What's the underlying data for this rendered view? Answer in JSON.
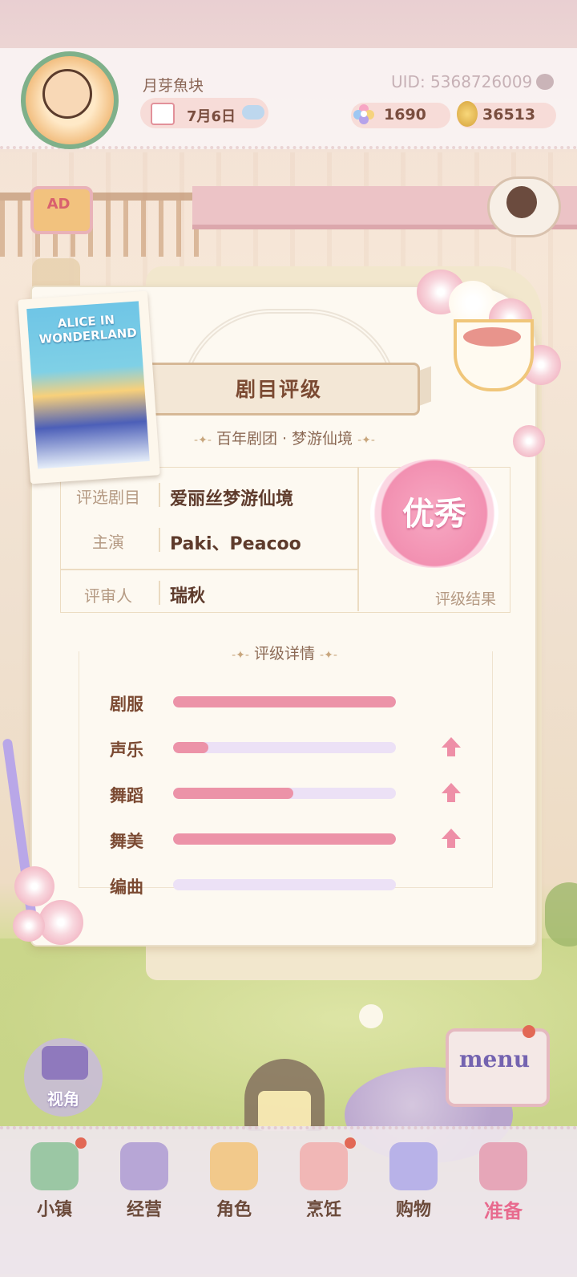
{
  "header": {
    "nickname": "月芽魚块",
    "date": "7月6日",
    "uid": "UID: 5368726009",
    "gems": "1690",
    "coins": "36513"
  },
  "side": {
    "ad_label": "AD"
  },
  "poster": {
    "title": "ALICE IN WONDERLAND"
  },
  "rating": {
    "title": "剧目评级",
    "subtitle": "百年剧团 · 梦游仙境",
    "rows": [
      {
        "label": "评选剧目",
        "value": "爱丽丝梦游仙境"
      },
      {
        "label": "主演",
        "value": "Paki、Peacoo"
      },
      {
        "label": "评审人",
        "value": "瑞秋"
      }
    ],
    "result_stamp": "优秀",
    "result_label": "评级结果",
    "details_title": "评级详情",
    "stats": [
      {
        "label": "剧服",
        "fill": 1.0,
        "arrow": false
      },
      {
        "label": "声乐",
        "fill": 0.16,
        "arrow": true
      },
      {
        "label": "舞蹈",
        "fill": 0.54,
        "arrow": true
      },
      {
        "label": "舞美",
        "fill": 1.0,
        "arrow": true
      },
      {
        "label": "编曲",
        "fill": 0.0,
        "arrow": false
      }
    ],
    "colors": {
      "fill": "#ec93a8",
      "track": "#ece1f6",
      "stamp": "#f290b1"
    }
  },
  "controls": {
    "view_label": "视角",
    "menu_label": "menu"
  },
  "nav": [
    {
      "label": "小镇",
      "icon": "map-icon",
      "badge": true
    },
    {
      "label": "经营",
      "icon": "shop-lock-icon",
      "badge": false
    },
    {
      "label": "角色",
      "icon": "character-icon",
      "badge": false
    },
    {
      "label": "烹饪",
      "icon": "cooking-icon",
      "badge": true
    },
    {
      "label": "购物",
      "icon": "shopping-bag-icon",
      "badge": false
    },
    {
      "label": "准备",
      "icon": "basket-icon",
      "badge": false,
      "active": true
    }
  ]
}
